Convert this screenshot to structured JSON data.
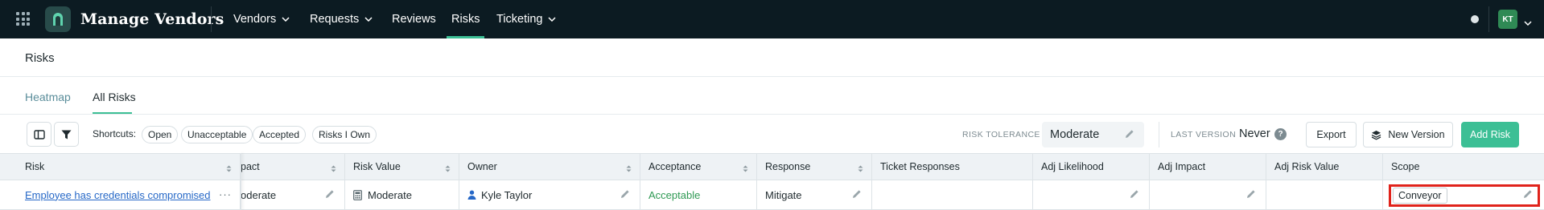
{
  "app": {
    "title": "Manage Vendors",
    "user_initials": "KT"
  },
  "nav": {
    "items": [
      {
        "label": "Vendors",
        "dropdown": true
      },
      {
        "label": "Requests",
        "dropdown": true
      },
      {
        "label": "Reviews",
        "dropdown": false
      },
      {
        "label": "Risks",
        "dropdown": false,
        "active": true
      },
      {
        "label": "Ticketing",
        "dropdown": true
      }
    ]
  },
  "page": {
    "title": "Risks",
    "tabs": [
      {
        "label": "Heatmap",
        "active": false
      },
      {
        "label": "All Risks",
        "active": true
      }
    ]
  },
  "toolbar": {
    "shortcuts_label": "Shortcuts:",
    "shortcuts": [
      "Open",
      "Unacceptable",
      "Accepted",
      "Risks I Own"
    ],
    "risk_tolerance_label": "RISK TOLERANCE",
    "risk_tolerance_value": "Moderate",
    "last_version_label": "LAST VERSION",
    "last_version_value": "Never",
    "help_glyph": "?",
    "export_label": "Export",
    "new_version_label": "New Version",
    "add_risk_label": "Add Risk"
  },
  "table": {
    "columns": [
      "Risk",
      "pact",
      "Risk Value",
      "Owner",
      "Acceptance",
      "Response",
      "Ticket Responses",
      "Adj Likelihood",
      "Adj Impact",
      "Adj Risk Value",
      "Scope"
    ],
    "rows": [
      {
        "risk": "Employee has credentials compromised",
        "more": "···",
        "impact": "oderate",
        "risk_value": "Moderate",
        "owner": "Kyle Taylor",
        "acceptance": "Acceptable",
        "response": "Mitigate",
        "ticket_responses": "",
        "adj_likelihood": "",
        "adj_impact": "",
        "adj_risk_value": "",
        "scope": "Conveyor"
      }
    ]
  },
  "colors": {
    "nav_bg": "#0c1b22",
    "accent": "#3cbf95",
    "link": "#2668c7",
    "acceptable": "#2f9a54",
    "highlight": "#e0231b"
  }
}
